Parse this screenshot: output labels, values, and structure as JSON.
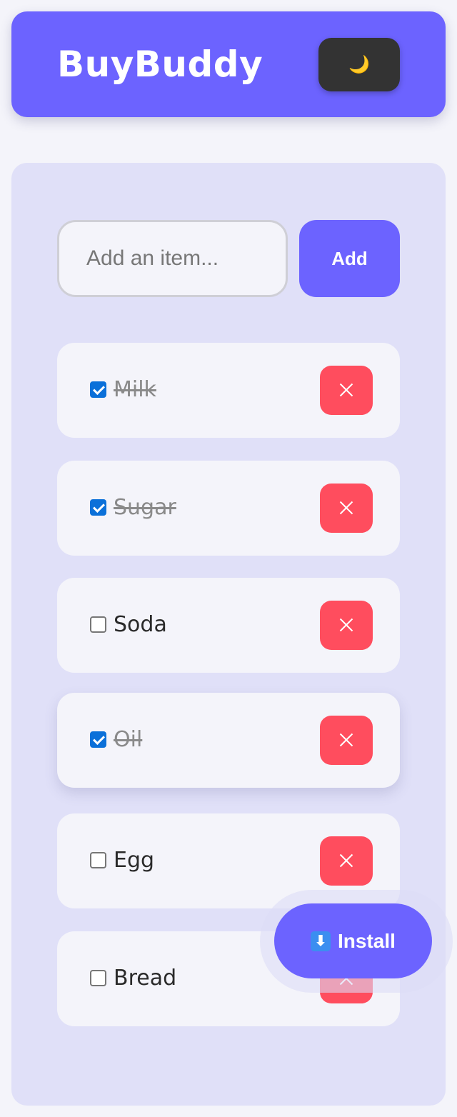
{
  "header": {
    "title": "BuyBuddy",
    "theme_icon": "🌙"
  },
  "add_form": {
    "placeholder": "Add an item...",
    "value": "",
    "add_label": "Add"
  },
  "items": [
    {
      "name": "Milk",
      "checked": true
    },
    {
      "name": "Sugar",
      "checked": true
    },
    {
      "name": "Soda",
      "checked": false
    },
    {
      "name": "Oil",
      "checked": true
    },
    {
      "name": "Egg",
      "checked": false
    },
    {
      "name": "Bread",
      "checked": false
    }
  ],
  "install": {
    "icon": "⬇",
    "label": "Install"
  },
  "colors": {
    "accent": "#6c63ff",
    "delete": "#ff4d5e",
    "checkbox": "#0b70d9"
  }
}
